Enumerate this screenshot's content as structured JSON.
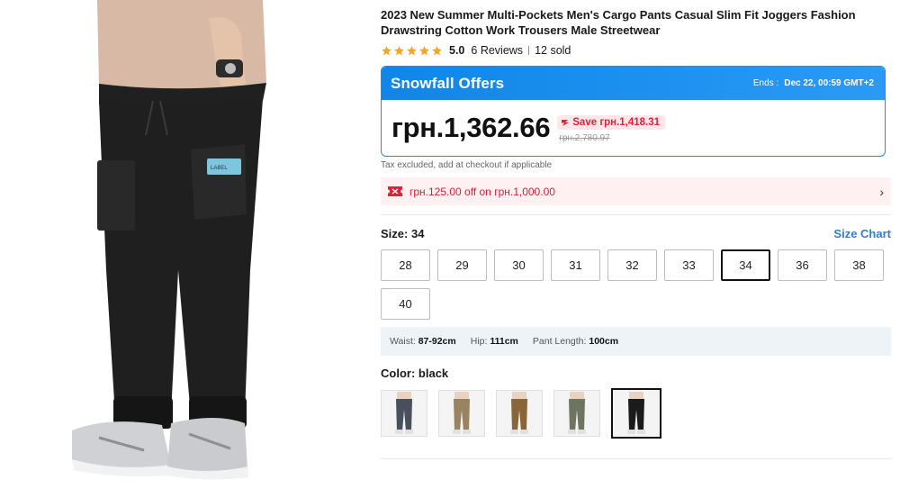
{
  "product": {
    "title": "2023 New Summer Multi-Pockets Men's Cargo Pants Casual Slim Fit Joggers Fashion Drawstring Cotton Work Trousers Male Streetwear",
    "rating": {
      "stars": 5,
      "score": "5.0",
      "reviews": "6 Reviews",
      "sold": "12 sold",
      "star_color": "#f5a623"
    },
    "image_icon": "cargo-pants-model-photo"
  },
  "offer": {
    "title": "Snowfall Offers",
    "ends_label": "Ends :",
    "ends_date": "Dec 22, 00:59 GMT+2",
    "price": "грн.1,362.66",
    "save": "Save грн.1,418.31",
    "original_price": "грн.2,780.97",
    "accent": "#1a8cef",
    "save_color": "#e0213a"
  },
  "tax_note": "Tax excluded, add at checkout if applicable",
  "coupon": {
    "text": "грн.125.00 off on грн.1,000.00",
    "arrow": "›",
    "icon": "coupon-ticket-icon"
  },
  "size": {
    "label": "Size:",
    "selected": "34",
    "chart_link": "Size Chart",
    "options": [
      "28",
      "29",
      "30",
      "31",
      "32",
      "33",
      "34",
      "36",
      "38",
      "40"
    ]
  },
  "measurements": {
    "waist_label": "Waist:",
    "waist": "87-92cm",
    "hip_label": "Hip:",
    "hip": "111cm",
    "pant_label": "Pant Length:",
    "pant": "100cm"
  },
  "color": {
    "label": "Color:",
    "selected": "black",
    "swatches": [
      {
        "name": "grey",
        "hex": "#4a4f5c"
      },
      {
        "name": "khaki",
        "hex": "#9a8361"
      },
      {
        "name": "brown",
        "hex": "#8a6538"
      },
      {
        "name": "army green",
        "hex": "#6e7460"
      },
      {
        "name": "black",
        "hex": "#1b1b1b"
      }
    ],
    "selected_index": 4
  }
}
